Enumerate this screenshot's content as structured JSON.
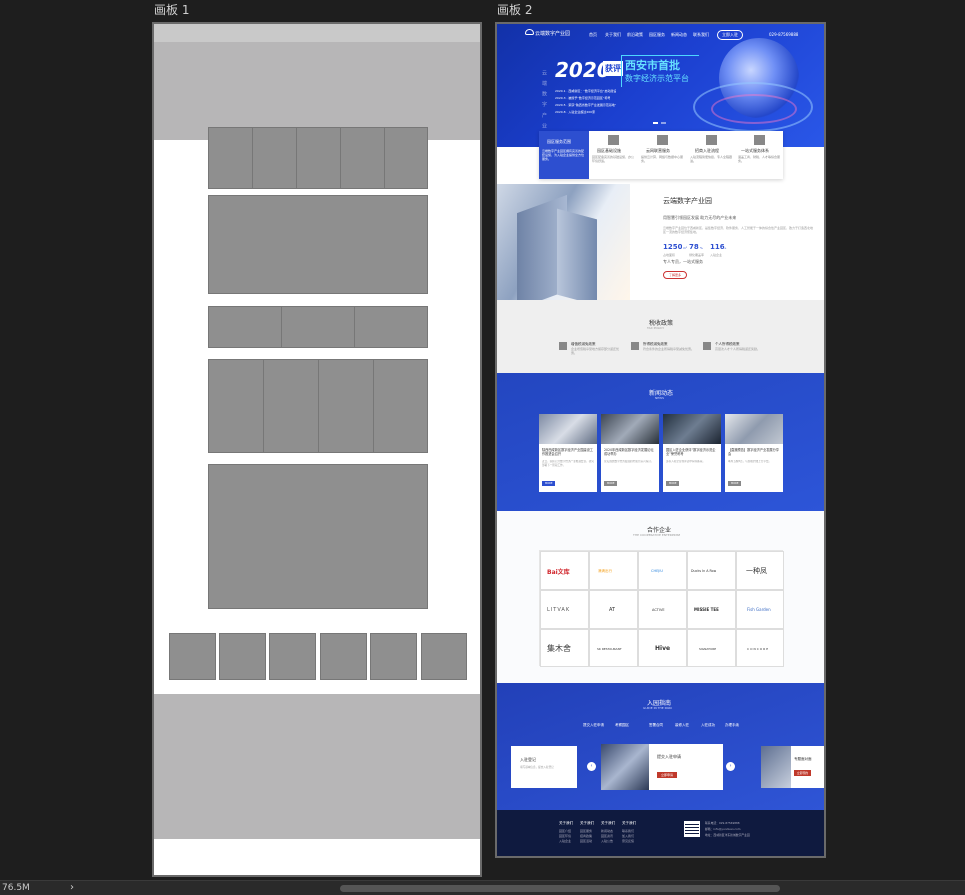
{
  "artboards": {
    "a1": "画板 1",
    "a2": "画板 2"
  },
  "hero": {
    "logo": "云端数字产业园",
    "nav": [
      "首页",
      "关于我们",
      "前沿政策",
      "园区服务",
      "新闻动态",
      "联系我们"
    ],
    "nav_btn": "立即入驻",
    "phone": "029-87569888",
    "year": "2020",
    "award": "获评",
    "t1": "西安市首批",
    "t2": "数字经济示范平台",
    "v_text": "云 端 数 字 产 业 园",
    "items": [
      "2020.1 · 西咸新区：“数字经济平台”启动建设",
      "2020.3 · 被授予“数字经济示范园区”称号",
      "2020.5 · 荣获“陕西省数字产业发展示范基地”",
      "2020.8 · 入驻企业超过200家"
    ]
  },
  "services": [
    {
      "title": "园区服务范围",
      "desc": "云端数字产业园区拥有完善的配套设施，为入驻企业提供全方位服务。"
    },
    {
      "title": "园区基础设施",
      "desc": "园区配备完善的基础设施，办公环境舒适。"
    },
    {
      "title": "云网联营服务",
      "desc": "提供云计算、网络与数据中心服务。"
    },
    {
      "title": "招商入驻流程",
      "desc": "入驻流程简便快捷，专人全程跟进。"
    },
    {
      "title": "一站式服务体系",
      "desc": "涵盖工商、财税、人才等综合服务。"
    }
  ],
  "about": {
    "title": "云端数字产业园",
    "subtitle": "用智慧引领园区发展 助力无尽的产业未来",
    "desc": "云端数字产业园位于西咸新区，是集数字经济、软件服务、人工智能于一体的综合性产业园区，致力于打造西北地区一流的数字经济聚集地。",
    "stats": [
      {
        "num": "1250",
        "unit": "m²",
        "label": "占地面积"
      },
      {
        "num": "78",
        "unit": "%",
        "label": "绿化覆盖率"
      },
      {
        "num": "116",
        "unit": "+",
        "label": "入驻企业"
      }
    ],
    "foot": "专人专员，一站式服务",
    "btn": "了解更多"
  },
  "policy": {
    "title": "税收政策",
    "sub": "TAX POLICY",
    "items": [
      {
        "title": "增值税减免政策",
        "desc": "企业增值税享受地方留存部分返还优惠。"
      },
      {
        "title": "所得税减免政策",
        "desc": "符合条件的企业所得税享受减免优惠。"
      },
      {
        "title": "个人所得税政策",
        "desc": "高层次人才个人所得税返还奖励。"
      }
    ]
  },
  "news": {
    "title": "新闻动态",
    "sub": "NEWS",
    "items": [
      {
        "title": "陕西西咸新区数字经济产业园建设工作推进会召开",
        "desc": "近日，园区召开数字经济产业推进会议，研究部署下一阶段工作。"
      },
      {
        "title": "2020年西咸新区数字经济发展论坛成功举办",
        "desc": "论坛围绕数字经济发展趋势展开深入探讨。"
      },
      {
        "title": "园区入驻企业获评“数字经济示范企业”荣誉称号",
        "desc": "多家入驻企业在评选中获得殊荣。"
      },
      {
        "title": "【直播预告】数字经济产业发展分享会",
        "desc": "本周五晚8点，与您相约线上分享会。"
      }
    ],
    "more": "MORE"
  },
  "partners": {
    "title": "合作企业",
    "sub": "THE COOPERATIVE ENTERPRISE",
    "logos": [
      "Bai文库",
      "滴滴出行",
      "CHEJIU",
      "Ducks In A Row",
      "一种凤",
      "LITVAK",
      "AT",
      "ACTIVE",
      "MISSIE TEE",
      "Fish Garden",
      "集木舍",
      "SK RESTAURANT",
      "Hive",
      "SIGNATURE",
      "CONCORE"
    ]
  },
  "guide": {
    "title": "入园指南",
    "sub": "GUIDE IN THE PARK",
    "tabs": [
      "提交入驻申请",
      "考察园区",
      "签署合同",
      "装修入驻",
      "入驻成功",
      "办理手续"
    ],
    "cards": [
      {
        "title": "入驻登记",
        "desc": "填写基本信息，提交入驻登记"
      },
      {
        "title": "提交入驻申请",
        "btn": "立即申请"
      },
      {
        "title": "专题面对面",
        "btn": "立即预约"
      }
    ]
  },
  "footer": {
    "cols": [
      {
        "h": "关于我们",
        "items": [
          "园区介绍",
          "园区环境",
          "入驻企业"
        ]
      },
      {
        "h": "关于我们",
        "items": [
          "园区服务",
          "招商政策",
          "园区活动"
        ]
      },
      {
        "h": "关于我们",
        "items": [
          "新闻动态",
          "园区资讯",
          "入驻公告"
        ]
      },
      {
        "h": "关于我们",
        "items": [
          "联系我们",
          "加入我们",
          "意见反馈"
        ]
      }
    ],
    "contact": [
      "联系电话：029-87569888",
      "邮箱：info@yunduan.com",
      "地址：西咸新区沣东新城数字产业园"
    ]
  },
  "status": {
    "zoom": "76.5M",
    "arrow": "›"
  }
}
